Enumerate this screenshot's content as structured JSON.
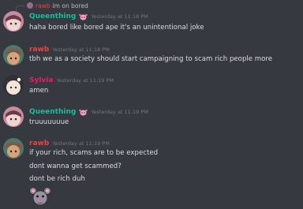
{
  "messages": [
    {
      "reply": {
        "name": "rawb",
        "text": "im on bored"
      },
      "author": "Queenthing",
      "author_color": "#1abc9c",
      "timestamp": "Yesterday at 11:18 PM",
      "lines": [
        "haha bored like bored ape it's an unintentional joke"
      ]
    },
    {
      "author": "rawb",
      "author_color": "#ed4245",
      "timestamp": "Yesterday at 11:18 PM",
      "lines": [
        "tbh we as a society should start campaigning to scam rich people more"
      ]
    },
    {
      "author": "Sylvia",
      "author_color": "#e91e63",
      "timestamp": "Yesterday at 11:19 PM",
      "lines": [
        "amen"
      ]
    },
    {
      "author": "Queenthing",
      "author_color": "#1abc9c",
      "timestamp": "Yesterday at 11:19 PM",
      "lines": [
        "truuuuuuue"
      ]
    },
    {
      "author": "rawb",
      "author_color": "#ed4245",
      "timestamp": "Yesterday at 11:19 PM",
      "lines": [
        "if your rich, scams are to be expected",
        "dont wanna get scammed?",
        "dont be rich duh"
      ],
      "sticker": "rat-sticker"
    }
  ],
  "colors": {
    "background": "#36393f",
    "text": "#dcddde",
    "timestamp": "#72767d"
  }
}
